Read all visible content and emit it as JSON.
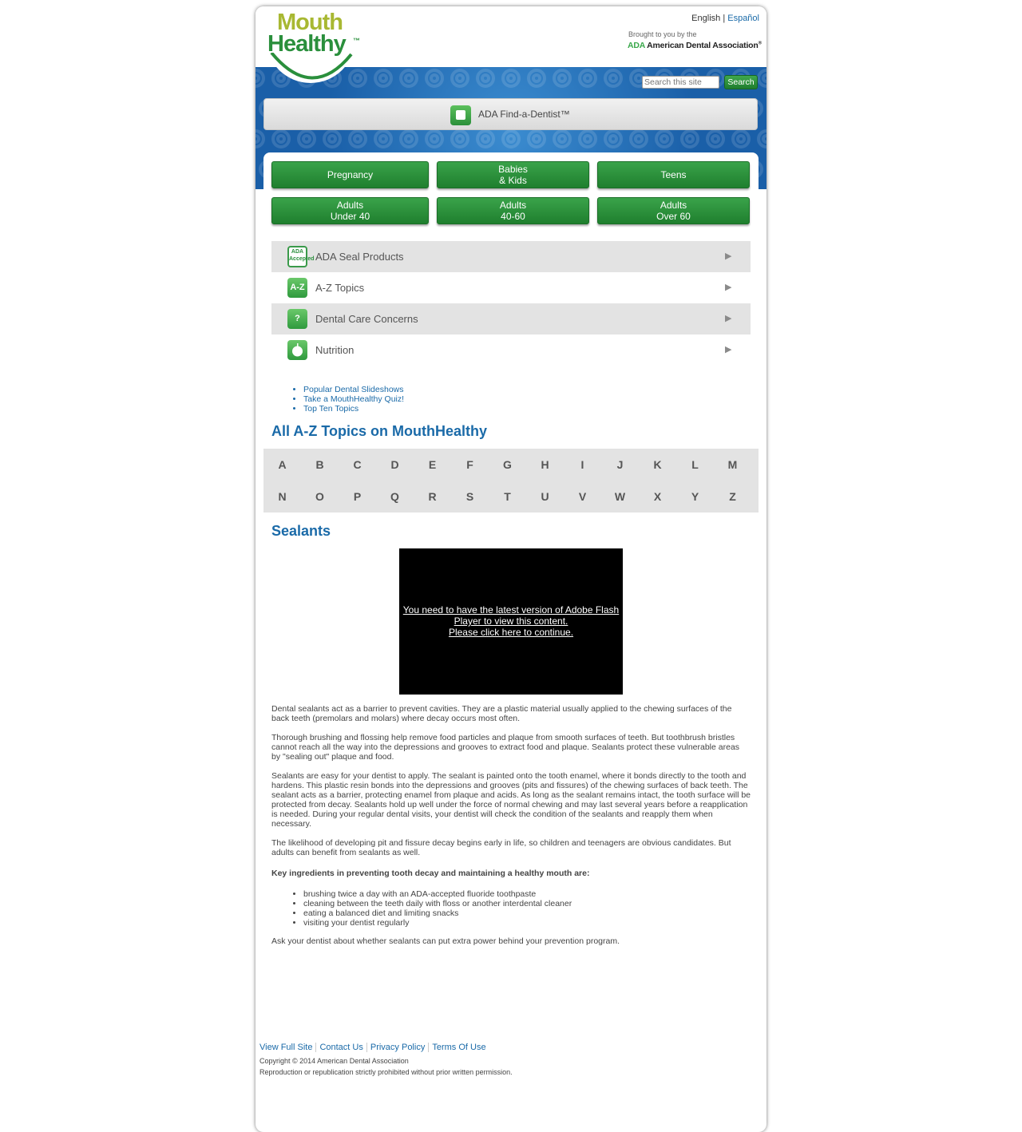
{
  "header": {
    "logo_mouth": "Mouth",
    "logo_healthy": "Healthy",
    "logo_tm": "™",
    "lang_english": "English",
    "lang_sep": "|",
    "lang_espanol": "Español",
    "brought": "Brought to you by the",
    "ada_abbr": "ADA",
    "ada_name": "American Dental Association",
    "ada_reg": "®"
  },
  "search": {
    "placeholder": "Search this site",
    "button": "Search"
  },
  "find_dentist": {
    "label": "ADA Find-a-Dentist™"
  },
  "audience_buttons": [
    {
      "label": "Pregnancy"
    },
    {
      "label": "Babies\n& Kids"
    },
    {
      "label": "Teens"
    },
    {
      "label": "Adults\nUnder 40"
    },
    {
      "label": "Adults\n40-60"
    },
    {
      "label": "Adults\nOver 60"
    }
  ],
  "categories": [
    {
      "label": "ADA Seal Products",
      "icon": "ada-seal-icon",
      "icon_text": "ADA Accepted"
    },
    {
      "label": "A-Z Topics",
      "icon": "a-z-icon",
      "icon_text": "A-Z"
    },
    {
      "label": "Dental Care Concerns",
      "icon": "question-icon",
      "icon_text": "?"
    },
    {
      "label": "Nutrition",
      "icon": "apple-icon",
      "icon_text": ""
    }
  ],
  "arrow_glyph": "▶",
  "quick_links": [
    "Popular Dental Slideshows",
    "Take a MouthHealthy Quiz!",
    "Top Ten Topics"
  ],
  "az_title": "All A-Z Topics on MouthHealthy",
  "letters": [
    "A",
    "B",
    "C",
    "D",
    "E",
    "F",
    "G",
    "H",
    "I",
    "J",
    "K",
    "L",
    "M",
    "N",
    "O",
    "P",
    "Q",
    "R",
    "S",
    "T",
    "U",
    "V",
    "W",
    "X",
    "Y",
    "Z"
  ],
  "article": {
    "title": "Sealants",
    "flash_line1": "You need to have the latest version of Adobe Flash",
    "flash_line2": "Player to view this content.",
    "flash_line3": "Please click here to continue.",
    "p1": "Dental sealants act as a barrier to prevent cavities. They are a plastic material usually applied to the chewing surfaces of the back teeth (premolars and molars) where decay occurs most often.",
    "p2": "Thorough brushing and flossing help remove food particles and plaque from smooth surfaces of teeth. But toothbrush bristles cannot reach all the way into the depressions and grooves to extract food and plaque. Sealants protect these vulnerable areas by \"sealing out\" plaque and food.",
    "p3": "Sealants are easy for your dentist to apply. The sealant is painted onto the tooth enamel, where it bonds directly to the tooth and hardens. This plastic resin bonds into the depressions and grooves (pits and fissures) of the chewing surfaces of back teeth. The sealant acts as a barrier, protecting enamel from plaque and acids. As long as the sealant remains intact, the tooth surface will be protected from decay. Sealants hold up well under the force of normal chewing and may last several years before a reapplication is needed. During your regular dental visits, your dentist will check the condition of the sealants and reapply them when necessary.",
    "p4": "The likelihood of developing pit and fissure decay begins early in life, so children and teenagers are obvious candidates. But adults can benefit from sealants as well.",
    "key_heading": "Key ingredients in preventing tooth decay and maintaining a healthy mouth are:",
    "key_items": [
      "brushing twice a day with an ADA-accepted fluoride toothpaste",
      "cleaning between the teeth daily with floss or another interdental cleaner",
      "eating a balanced diet and limiting snacks",
      "visiting your dentist regularly"
    ],
    "closing": "Ask your dentist about whether sealants can put extra power behind your prevention program."
  },
  "footer": {
    "links": [
      "View Full Site",
      "Contact Us",
      "Privacy Policy",
      "Terms Of Use"
    ],
    "copyright": "Copyright © 2014 American Dental Association",
    "reproduction": "Reproduction or republication strictly prohibited without prior written permission."
  },
  "colors": {
    "brand_green": "#2a8f3c",
    "brand_lime": "#a8b832",
    "link_blue": "#1a6aa8",
    "band_blue": "#1a5fa8"
  }
}
